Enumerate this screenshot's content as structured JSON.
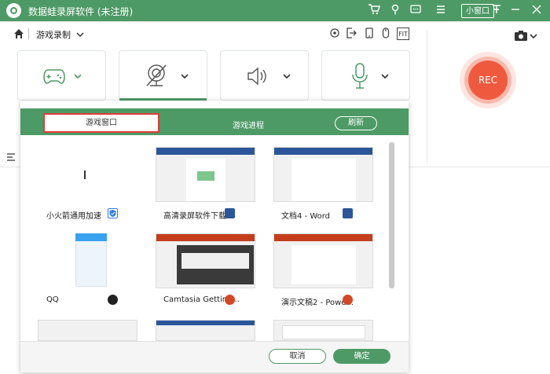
{
  "app": {
    "title": "数据蛙录屏软件 (未注册)",
    "mini_window_label": "小窗口",
    "accent_color": "#4e9a66"
  },
  "breadcrumb": {
    "current": "游戏录制"
  },
  "toolbar_icons": [
    "settings-icon",
    "export-icon",
    "phone-icon",
    "mouse-icon",
    "fit-icon"
  ],
  "fit_label": "FIT",
  "sources": [
    {
      "name": "game-controller-icon"
    },
    {
      "name": "webcam-icon"
    },
    {
      "name": "speaker-icon"
    },
    {
      "name": "microphone-icon"
    }
  ],
  "rec_label": "REC",
  "dialog": {
    "tabs": [
      {
        "label": "游戏窗口",
        "active": true
      },
      {
        "label": "游戏进程",
        "active": false
      }
    ],
    "refresh_label": "刷新",
    "windows": [
      {
        "label": "小火箭通用加速",
        "badge": "shield-badge"
      },
      {
        "label": "高清录屏软件下载...",
        "badge": "word-badge"
      },
      {
        "label": "文档4 - Word",
        "badge": "word-badge"
      },
      {
        "label": "QQ",
        "badge": "qq-badge"
      },
      {
        "label": "Camtasia Getting...",
        "badge": "powerpoint-badge"
      },
      {
        "label": "演示文稿2 - Powe...",
        "badge": "powerpoint-badge"
      }
    ],
    "cancel_label": "取消",
    "confirm_label": "确定"
  }
}
